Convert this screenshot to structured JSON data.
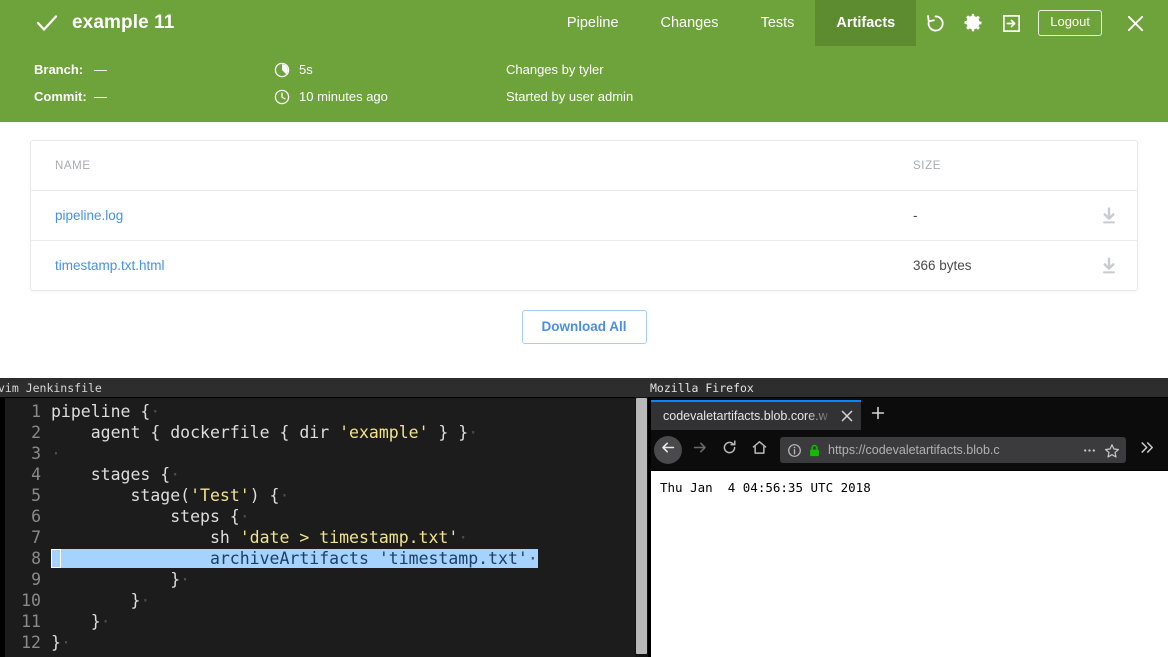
{
  "jenkins": {
    "header": {
      "status_icon": "check-icon",
      "run_title": "example 11",
      "tabs": [
        {
          "label": "Pipeline",
          "active": false
        },
        {
          "label": "Changes",
          "active": false
        },
        {
          "label": "Tests",
          "active": false
        },
        {
          "label": "Artifacts",
          "active": true
        }
      ],
      "rerun_icon": "replay-icon",
      "settings_icon": "gear-icon",
      "exit_icon": "logout-arrow-icon",
      "logout_label": "Logout",
      "close_icon": "close-icon",
      "bg_color": "#6DA33A",
      "active_tab_color": "#5C8B30"
    },
    "meta": {
      "branch_label": "Branch:",
      "branch_value": "—",
      "commit_label": "Commit:",
      "commit_value": "—",
      "duration_icon": "duration-icon",
      "duration_value": "5s",
      "time_icon": "clock-icon",
      "time_value": "10 minutes ago",
      "changes_by": "Changes by tyler",
      "started_by": "Started by user admin"
    },
    "artifacts": {
      "columns": [
        "NAME",
        "SIZE"
      ],
      "rows": [
        {
          "name": "pipeline.log",
          "size": "-",
          "download_icon": "download-icon"
        },
        {
          "name": "timestamp.txt.html",
          "size": "366 bytes",
          "download_icon": "download-icon"
        }
      ],
      "download_all_label": "Download All",
      "link_color": "#4a90e2"
    }
  },
  "vim": {
    "window_title": "vim Jenkinsfile",
    "lines": [
      {
        "n": "1",
        "indent": 0,
        "code": "pipeline {",
        "trail": "·"
      },
      {
        "n": "2",
        "indent": 4,
        "code": "agent { dockerfile { dir ",
        "str": "'example'",
        "after": " } }",
        "trail": "·"
      },
      {
        "n": "3",
        "indent": 0,
        "code": "",
        "trail": "·"
      },
      {
        "n": "4",
        "indent": 4,
        "code": "stages {",
        "trail": "·"
      },
      {
        "n": "5",
        "indent": 8,
        "code": "stage(",
        "str": "'Test'",
        "after": ") {",
        "trail": "·"
      },
      {
        "n": "6",
        "indent": 12,
        "code": "steps {",
        "trail": "·"
      },
      {
        "n": "7",
        "indent": 16,
        "code": "sh ",
        "str": "'date > timestamp.txt'",
        "after": "",
        "trail": "·"
      },
      {
        "n": "8",
        "indent": 16,
        "code": "archiveArtifacts ",
        "str": "'timestamp.txt'",
        "after": "",
        "trail": "·",
        "selected": true
      },
      {
        "n": "9",
        "indent": 12,
        "code": "}",
        "trail": "·"
      },
      {
        "n": "10",
        "indent": 8,
        "code": "}",
        "trail": "·"
      },
      {
        "n": "11",
        "indent": 4,
        "code": "}",
        "trail": "·"
      },
      {
        "n": "12",
        "indent": 0,
        "code": "}",
        "trail": "·"
      }
    ]
  },
  "firefox": {
    "window_title": "Mozilla Firefox",
    "tab_title": "codevaletartifacts.blob.core.w",
    "tab_close_icon": "close-icon",
    "new_tab_icon": "plus-icon",
    "back_icon": "arrow-left-icon",
    "forward_icon": "arrow-right-icon",
    "reload_icon": "reload-icon",
    "home_icon": "home-icon",
    "identity_icon": "info-icon",
    "lock_icon": "padlock-icon",
    "url": "https://codevaletartifacts.blob.c",
    "page_action_icon": "ellipsis-icon",
    "bookmark_icon": "star-icon",
    "overflow_icon": "chevron-double-right-icon",
    "page_text": "Thu Jan  4 04:56:35 UTC 2018"
  }
}
